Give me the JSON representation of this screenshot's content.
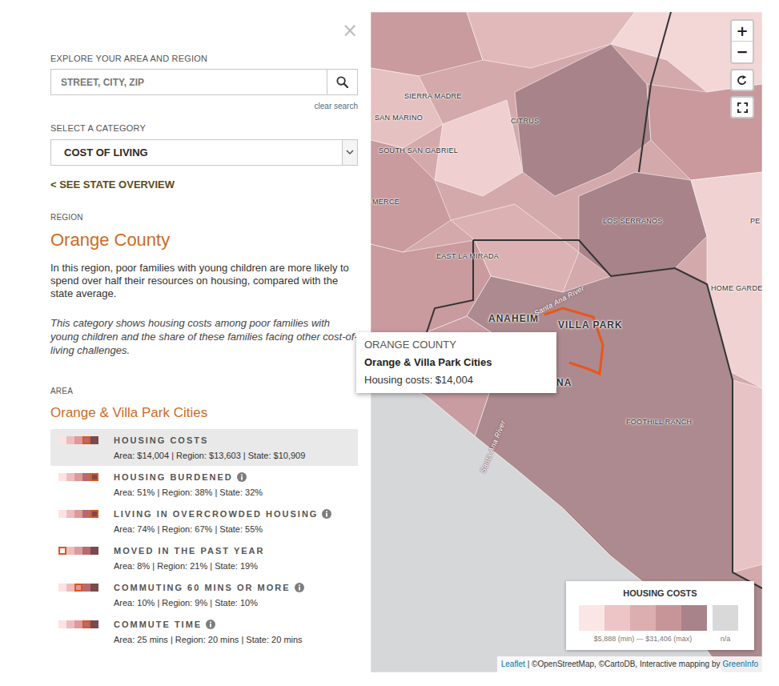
{
  "panel": {
    "close": "×",
    "search_label": "EXPLORE YOUR AREA AND REGION",
    "search_placeholder": "STREET, CITY, ZIP",
    "clear_search": "clear search",
    "category_label": "SELECT A CATEGORY",
    "category": "COST OF LIVING",
    "overview_link": "< SEE STATE OVERVIEW",
    "region_label": "REGION",
    "region": "Orange County",
    "region_summary": "In this region, poor families with young children are more likely to spend over half their resources on housing, compared with the state average.",
    "category_note": "This category shows housing costs among poor families with young children and the share of these families facing other cost-of-living challenges.",
    "area_label": "AREA",
    "area": "Orange & Villa Park Cities"
  },
  "metrics": [
    {
      "title": "HOUSING COSTS",
      "has_info": false,
      "bin": 3,
      "selected": true,
      "values": "Area: $14,004 | Region: $13,603 | State: $10,909"
    },
    {
      "title": "HOUSING BURDENED",
      "has_info": true,
      "bin": 4,
      "selected": false,
      "values": "Area: 51% | Region: 38% | State: 32%"
    },
    {
      "title": "LIVING IN OVERCROWDED HOUSING",
      "has_info": true,
      "bin": 4,
      "selected": false,
      "values": "Area: 74% | Region: 67% | State: 55%"
    },
    {
      "title": "MOVED IN THE PAST YEAR",
      "has_info": false,
      "bin": 0,
      "selected": false,
      "values": "Area: 8% | Region: 21% | State: 19%"
    },
    {
      "title": "COMMUTING 60 MINS OR MORE",
      "has_info": true,
      "bin": 2,
      "selected": false,
      "values": "Area: 10% | Region: 9% | State: 10%"
    },
    {
      "title": "COMMUTE TIME",
      "has_info": true,
      "bin": 3,
      "selected": false,
      "values": "Area: 25 mins | Region: 20 mins | State: 20 mins"
    }
  ],
  "map": {
    "labels": [
      {
        "text": "SIERRA MADRE",
        "kind": "place"
      },
      {
        "text": "SAN MARINO",
        "kind": "place"
      },
      {
        "text": "CITRUS",
        "kind": "place"
      },
      {
        "text": "SOUTH SAN GABRIEL",
        "kind": "place"
      },
      {
        "text": "MERCE",
        "kind": "place"
      },
      {
        "text": "LOS SERRANOS",
        "kind": "place"
      },
      {
        "text": "PE",
        "kind": "place"
      },
      {
        "text": "EAST LA MIRADA",
        "kind": "place"
      },
      {
        "text": "HOME GARDE",
        "kind": "place"
      },
      {
        "text": "ANAHEIM",
        "kind": "major"
      },
      {
        "text": "Santa Ana River",
        "kind": "river"
      },
      {
        "text": "VILLA PARK",
        "kind": "major"
      },
      {
        "text": "NA",
        "kind": "major"
      },
      {
        "text": "FOOTHILL RANCH",
        "kind": "place"
      },
      {
        "text": "Santa Ana River",
        "kind": "river"
      }
    ],
    "controls": {
      "zoom_in": "+",
      "zoom_out": "−"
    },
    "tooltip": {
      "region": "ORANGE COUNTY",
      "area": "Orange & Villa Park Cities",
      "value": "Housing costs: $14,004"
    },
    "legend": {
      "title": "HOUSING COSTS",
      "swatches": [
        {
          "color": "#fbe6e6"
        },
        {
          "color": "#eec5c6"
        },
        {
          "color": "#dcaeb0"
        },
        {
          "color": "#c79598"
        },
        {
          "color": "#a8848a"
        }
      ],
      "range": "$5,888 (min) — $31,406 (max)",
      "na": {
        "label": "n/a",
        "color": "#d9d9d9"
      }
    },
    "attribution": [
      {
        "text": "Leaflet",
        "link": true
      },
      {
        "text": "| ©OpenStreetMap, ©CartoDB, Interactive mapping by",
        "link": false
      },
      {
        "text": "GreenInfo",
        "link": true
      }
    ]
  }
}
